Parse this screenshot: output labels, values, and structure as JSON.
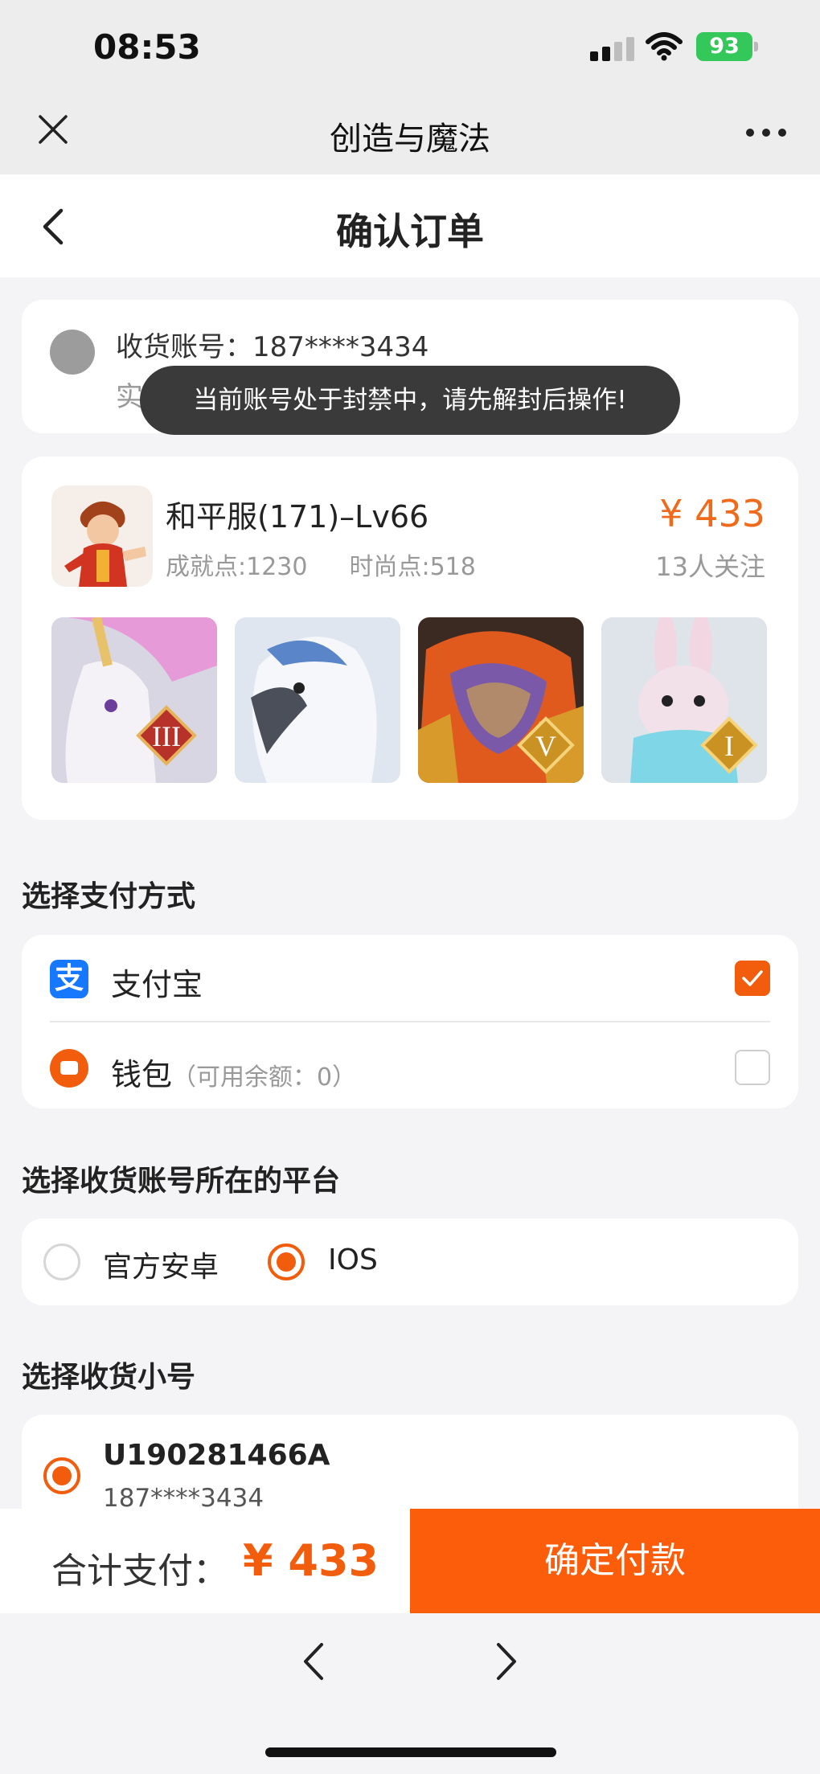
{
  "status_bar": {
    "time": "08:53",
    "battery": "93"
  },
  "header": {
    "app_title": "创造与魔法"
  },
  "page": {
    "title": "确认订单"
  },
  "address": {
    "account_label": "收货账号：187****3434",
    "sub_text": "实名"
  },
  "toast": "当前账号处于封禁中，请先解封后操作!",
  "product": {
    "name": "和平服(171)–Lv66",
    "achievement": "成就点:1230",
    "fashion": "时尚点:518",
    "price": "¥ 433",
    "followers": "13人关注",
    "thumbnails": [
      {
        "name": "unicorn-mount",
        "badge": "III"
      },
      {
        "name": "griffin-mount",
        "badge": ""
      },
      {
        "name": "lion-mount",
        "badge": "V"
      },
      {
        "name": "rabbit-mount",
        "badge": "I"
      }
    ]
  },
  "payment": {
    "section_title": "选择支付方式",
    "options": [
      {
        "label": "支付宝",
        "icon": "alipay-icon",
        "checked": true
      },
      {
        "label": "钱包",
        "note": "（可用余额：0）",
        "icon": "wallet-icon",
        "checked": false
      }
    ]
  },
  "platform": {
    "section_title": "选择收货账号所在的平台",
    "options": [
      {
        "label": "官方安卓",
        "selected": false
      },
      {
        "label": "IOS",
        "selected": true
      }
    ]
  },
  "sub_account": {
    "section_title": "选择收货小号",
    "id": "U190281466A",
    "phone": "187****3434"
  },
  "footer": {
    "total_label": "合计支付：",
    "total_amount": "¥ 433",
    "confirm_label": "确定付款"
  },
  "colors": {
    "accent": "#fb5d0a",
    "price": "#f06a1c",
    "alipay": "#1677ff",
    "battery": "#34c759"
  }
}
